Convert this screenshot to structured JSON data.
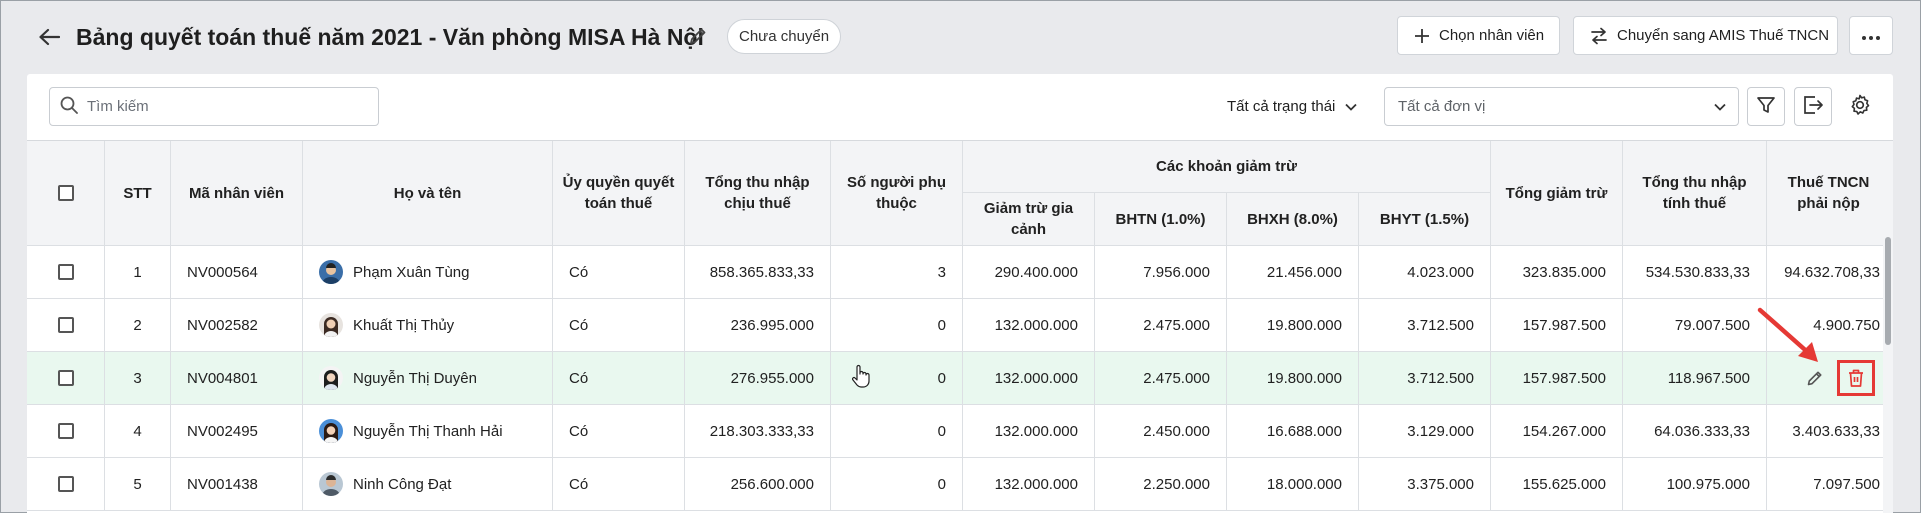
{
  "header": {
    "title": "Bảng quyết toán thuế năm 2021 - Văn phòng MISA Hà Nội",
    "status": "Chưa chuyển",
    "choose_employee_label": "Chọn nhân viên",
    "transfer_label": "Chuyển sang AMIS Thuế TNCN"
  },
  "toolbar": {
    "search_placeholder": "Tìm kiếm",
    "status_filter_label": "Tất cả trạng thái",
    "unit_select_placeholder": "Tất cả đơn vị"
  },
  "table": {
    "headers": {
      "stt": "STT",
      "employee_code": "Mã nhân viên",
      "full_name": "Họ và tên",
      "authorized": "Ủy quyền quyết toán thuế",
      "taxable_income": "Tổng thu nhập chịu thuế",
      "dependents": "Số người phụ thuộc",
      "deductions_group": "Các khoản giảm trừ",
      "family_deduction": "Giảm trừ gia cảnh",
      "bhtn": "BHTN (1.0%)",
      "bhxh": "BHXH (8.0%)",
      "bhyt": "BHYT (1.5%)",
      "total_deduction": "Tổng giảm trừ",
      "assessable_income": "Tổng thu nhập tính thuế",
      "pit_payable": "Thuế TNCN phải nộp"
    },
    "rows": [
      {
        "stt": "1",
        "code": "NV000564",
        "name": "Phạm Xuân Tùng",
        "authorized": "Có",
        "taxable_income": "858.365.833,33",
        "dependents": "3",
        "family_deduction": "290.400.000",
        "bhtn": "7.956.000",
        "bhxh": "21.456.000",
        "bhyt": "4.023.000",
        "total_deduction": "323.835.000",
        "assessable_income": "534.530.833,33",
        "pit": "94.632.708,33"
      },
      {
        "stt": "2",
        "code": "NV002582",
        "name": "Khuất Thị Thủy",
        "authorized": "Có",
        "taxable_income": "236.995.000",
        "dependents": "0",
        "family_deduction": "132.000.000",
        "bhtn": "2.475.000",
        "bhxh": "19.800.000",
        "bhyt": "3.712.500",
        "total_deduction": "157.987.500",
        "assessable_income": "79.007.500",
        "pit": "4.900.750"
      },
      {
        "stt": "3",
        "code": "NV004801",
        "name": "Nguyễn Thị Duyên",
        "authorized": "Có",
        "taxable_income": "276.955.000",
        "dependents": "0",
        "family_deduction": "132.000.000",
        "bhtn": "2.475.000",
        "bhxh": "19.800.000",
        "bhyt": "3.712.500",
        "total_deduction": "157.987.500",
        "assessable_income": "118.967.500",
        "pit": ""
      },
      {
        "stt": "4",
        "code": "NV002495",
        "name": "Nguyễn Thị Thanh Hải",
        "authorized": "Có",
        "taxable_income": "218.303.333,33",
        "dependents": "0",
        "family_deduction": "132.000.000",
        "bhtn": "2.450.000",
        "bhxh": "16.688.000",
        "bhyt": "3.129.000",
        "total_deduction": "154.267.000",
        "assessable_income": "64.036.333,33",
        "pit": "3.403.633,33"
      },
      {
        "stt": "5",
        "code": "NV001438",
        "name": "Ninh Công Đạt",
        "authorized": "Có",
        "taxable_income": "256.600.000",
        "dependents": "0",
        "family_deduction": "132.000.000",
        "bhtn": "2.250.000",
        "bhxh": "18.000.000",
        "bhyt": "3.375.000",
        "total_deduction": "155.625.000",
        "assessable_income": "100.975.000",
        "pit": "7.097.500"
      }
    ]
  },
  "colors": {
    "highlight_row": "#e9f8ef",
    "delete_outline": "#e53935",
    "annotation_arrow": "#e53935"
  }
}
